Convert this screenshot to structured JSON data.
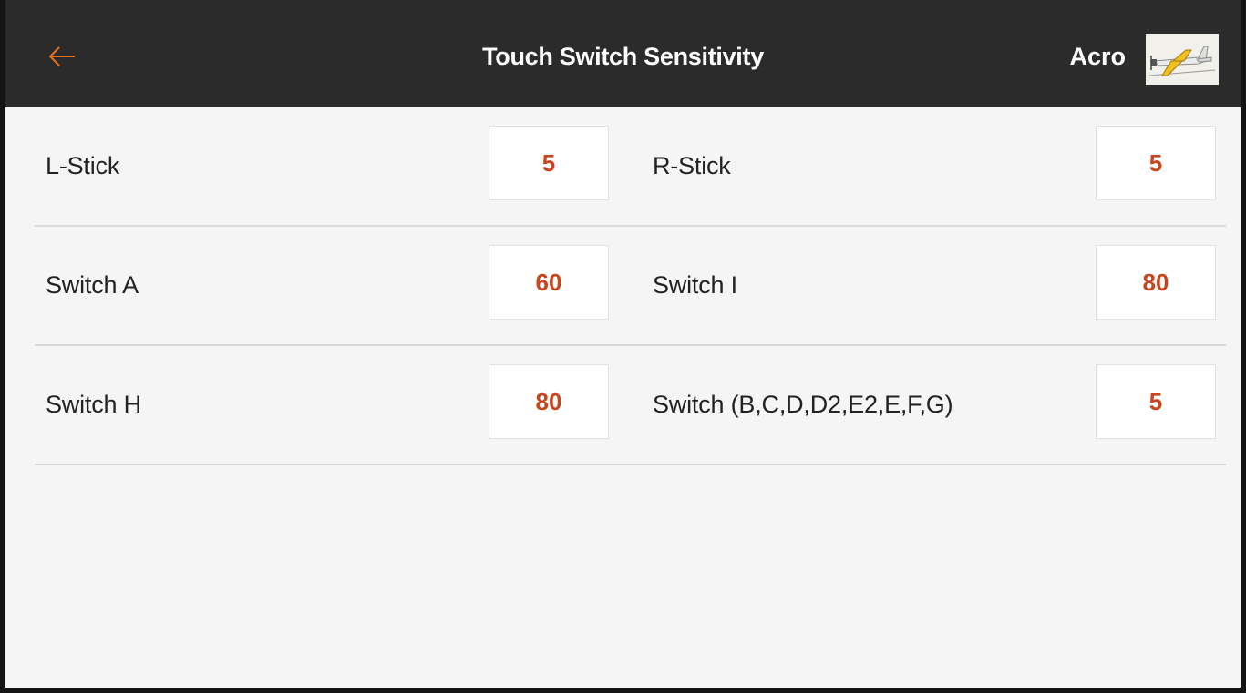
{
  "header": {
    "title": "Touch Switch Sensitivity",
    "model_name": "Acro",
    "back_icon": "arrow-left-icon",
    "model_icon": "airplane-icon"
  },
  "colors": {
    "header_background": "#2b2b2b",
    "accent": "#e8711f",
    "value_text": "#c8461d",
    "page_background": "#f5f5f5"
  },
  "rows": [
    {
      "left": {
        "label": "L-Stick",
        "value": "5"
      },
      "right": {
        "label": "R-Stick",
        "value": "5"
      }
    },
    {
      "left": {
        "label": "Switch A",
        "value": "60"
      },
      "right": {
        "label": "Switch I",
        "value": "80"
      }
    },
    {
      "left": {
        "label": "Switch H",
        "value": "80"
      },
      "right": {
        "label": "Switch (B,C,D,D2,E2,E,F,G)",
        "value": "5"
      }
    }
  ]
}
